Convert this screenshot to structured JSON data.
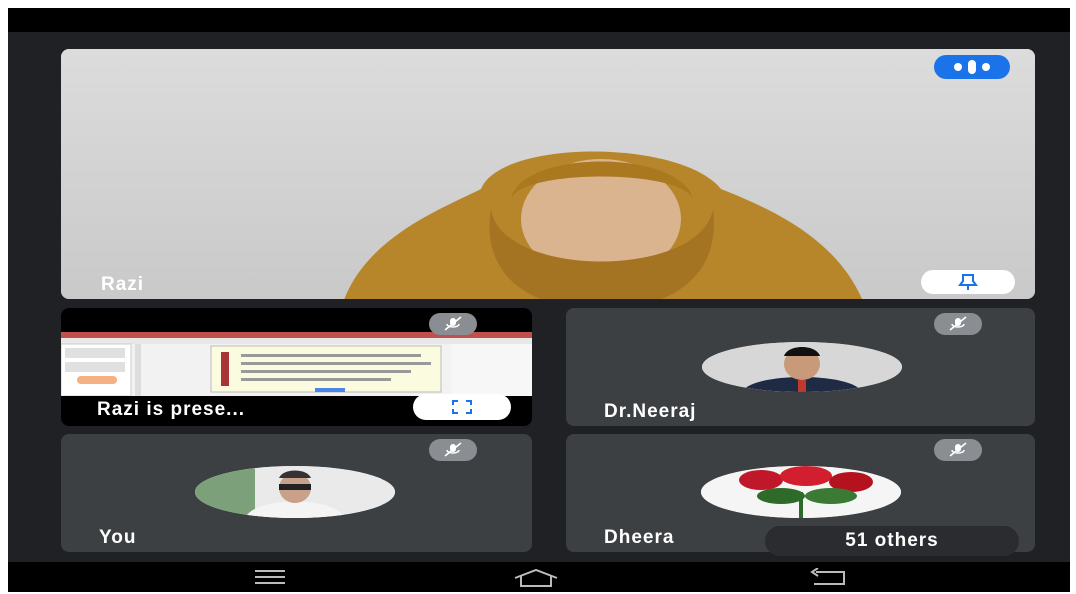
{
  "main_speaker": {
    "name": "Razi"
  },
  "presentation": {
    "label": "Razi is prese..."
  },
  "participants": [
    {
      "name": "Dr.Neeraj"
    },
    {
      "name": "You"
    },
    {
      "name": "Dheera"
    }
  ],
  "others": {
    "label": "51 others"
  },
  "icons": {
    "audio_indicator": "audio-level-icon",
    "pin": "pin-icon",
    "muted": "mic-off-icon",
    "fullscreen": "fullscreen-icon",
    "nav_menu": "menu-lines-icon",
    "nav_home": "home-icon",
    "nav_back": "back-icon"
  },
  "colors": {
    "accent_blue": "#1a73e8",
    "tile": "#3c4043",
    "background": "#202124"
  }
}
